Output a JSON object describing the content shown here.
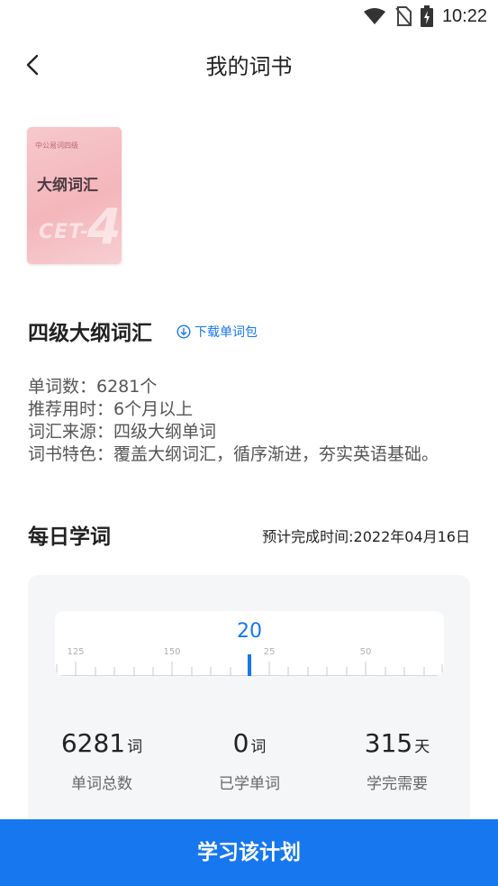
{
  "status_bar": {
    "time": "10:22"
  },
  "header": {
    "title": "我的词书"
  },
  "cover": {
    "small_text": "中公易词四级",
    "title": "大纲词汇",
    "cet": "CET-",
    "level": "4"
  },
  "book": {
    "name": "四级大纲词汇",
    "download_label": "下载单词包",
    "info": [
      "单词数：6281个",
      "推荐用时：6个月以上",
      "词汇来源：四级大纲单词",
      "词书特色：覆盖大纲词汇，循序渐进，夯实英语基础。"
    ]
  },
  "daily": {
    "title": "每日学词",
    "finish_time": "预计完成时间:2022年04月16日",
    "selected_value": "20",
    "tick_labels": [
      "125",
      "150",
      "25",
      "50"
    ],
    "accent_color": "#1677ee"
  },
  "stats": [
    {
      "value": "6281",
      "unit": "词",
      "label": "单词总数"
    },
    {
      "value": "0",
      "unit": "词",
      "label": "已学单词"
    },
    {
      "value": "315",
      "unit": "天",
      "label": "学完需要"
    }
  ],
  "footer": {
    "button_label": "学习该计划"
  }
}
